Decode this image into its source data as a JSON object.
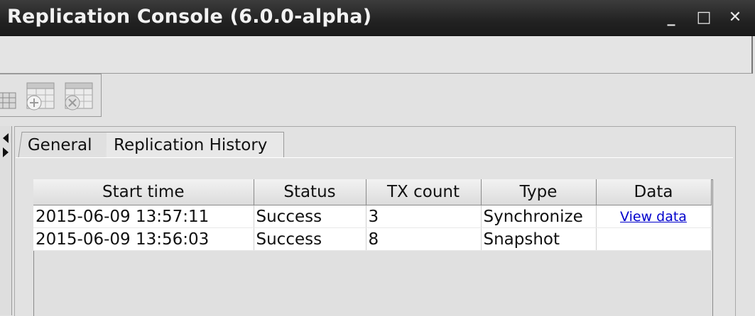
{
  "window": {
    "title": "Replication Console (6.0.0-alpha)",
    "controls": {
      "minimize": "_",
      "maximize": "□",
      "close": "✕"
    }
  },
  "tabs": [
    {
      "label": "General",
      "active": false
    },
    {
      "label": "Replication History",
      "active": true
    }
  ],
  "history_table": {
    "columns": [
      "Start time",
      "Status",
      "TX count",
      "Type",
      "Data"
    ],
    "rows": [
      {
        "start_time": "2015-06-09 13:57:11",
        "status": "Success",
        "tx_count": "3",
        "type": "Synchronize",
        "data": "View data"
      },
      {
        "start_time": "2015-06-09 13:56:03",
        "status": "Success",
        "tx_count": "8",
        "type": "Snapshot",
        "data": ""
      }
    ]
  },
  "colors": {
    "titlebar": "#222222",
    "link": "#0000cc",
    "background": "#e2e2e2"
  },
  "icons": [
    "open-table-icon",
    "add-table-icon",
    "remove-table-icon"
  ]
}
